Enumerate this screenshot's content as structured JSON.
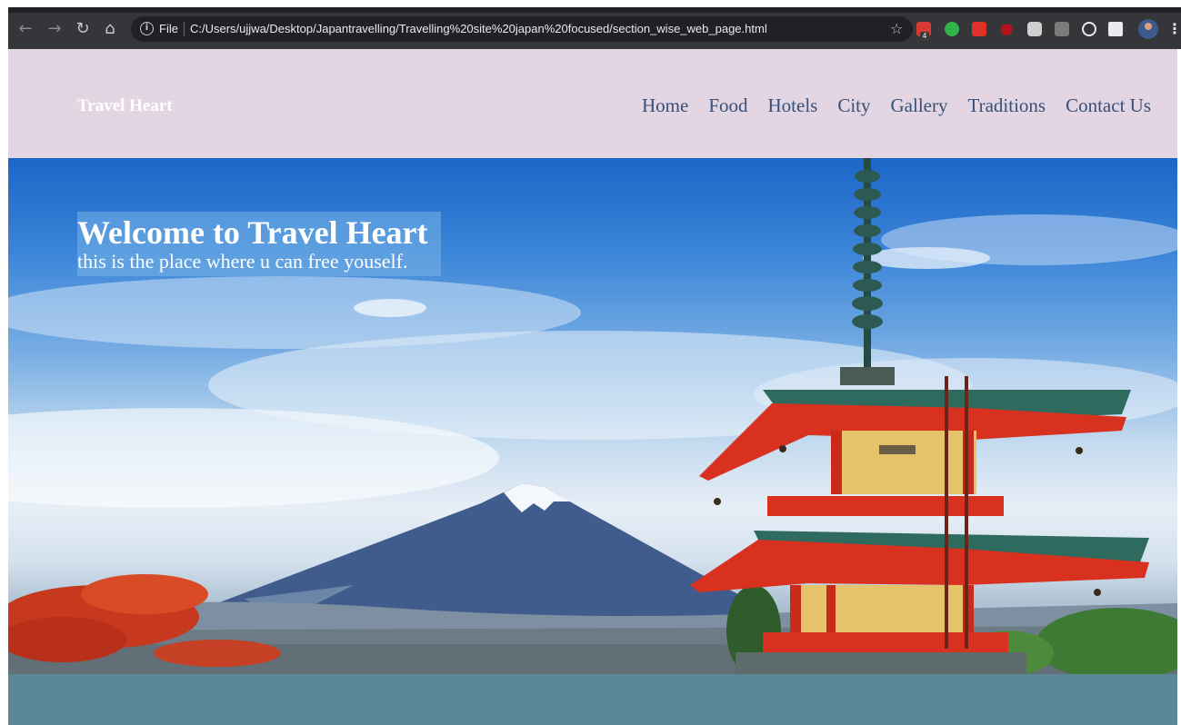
{
  "browser": {
    "scheme_label": "File",
    "url": "C:/Users/ujjwa/Desktop/Japantravelling/Travelling%20site%20japan%20focused/section_wise_web_page.html",
    "extension_badge": "4",
    "icons": [
      "back-icon",
      "forward-icon",
      "reload-icon",
      "home-icon",
      "info-icon",
      "star-icon",
      "menu-icon"
    ]
  },
  "site": {
    "brand": "Travel Heart",
    "nav": [
      "Home",
      "Food",
      "Hotels",
      "City",
      "Gallery",
      "Traditions",
      "Contact Us"
    ]
  },
  "hero": {
    "title": "Welcome to Travel Heart",
    "subtitle": "this is the place where u can free youself."
  },
  "colors": {
    "header_bg": "#e3d6e2",
    "nav_link": "#35507a",
    "footer_band": "#5c8797",
    "sky_top": "#1c66c8",
    "pagoda_red": "#d8311f",
    "roof_green": "#2f6a5f"
  }
}
